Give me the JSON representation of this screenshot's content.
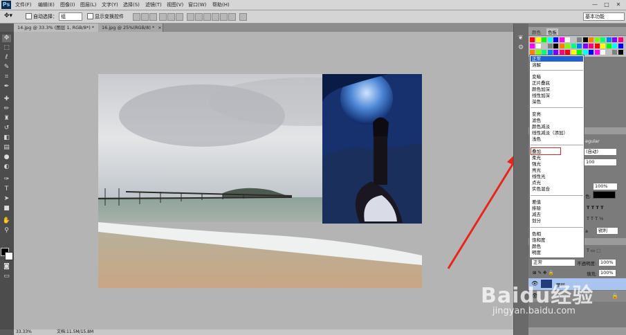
{
  "app": {
    "logo": "Ps",
    "menus": [
      "文件(F)",
      "编辑(E)",
      "图像(I)",
      "图层(L)",
      "文字(Y)",
      "选择(S)",
      "滤镜(T)",
      "视图(V)",
      "窗口(W)",
      "帮助(H)"
    ],
    "window_controls": [
      "—",
      "□",
      "✕"
    ]
  },
  "options": {
    "auto_select_label": "自动选择：",
    "auto_select_value": "组",
    "show_transform_label": "显示变换控件",
    "workspace": "基本功能"
  },
  "tabs": [
    {
      "label": "14.jpg @ 33.3% (图层 1, RGB/8*) *",
      "close": "×"
    },
    {
      "label": "16.jpg @ 25%(RGB/8) *",
      "close": "×"
    }
  ],
  "status": {
    "zoom": "33.33%",
    "doc": "文档:11.5M/15.8M"
  },
  "color_panel": {
    "tabs": [
      "颜色",
      "色板"
    ]
  },
  "blend_modes": {
    "highlighted": "正常",
    "groups": [
      [
        "正常",
        "溶解"
      ],
      [
        "变暗",
        "正片叠底",
        "颜色加深",
        "线性加深",
        "深色"
      ],
      [
        "变亮",
        "滤色",
        "颜色减淡",
        "线性减淡（添加）",
        "浅色"
      ],
      [
        "叠加",
        "柔光",
        "强光",
        "亮光",
        "线性光",
        "点光",
        "实色混合"
      ],
      [
        "差值",
        "排除",
        "减去",
        "划分"
      ],
      [
        "色相",
        "饱和度",
        "颜色",
        "明度"
      ]
    ],
    "boxed": "叠加"
  },
  "char_panel": {
    "regular": "egular",
    "auto": "(自动)",
    "size": "100",
    "scale": "100%",
    "color_label": "色:",
    "aa_label": "a",
    "aa_value": "锐利"
  },
  "layers_panel": {
    "blend_value": "正常",
    "opacity_label": "不透明度:",
    "opacity_value": "100%",
    "fill_label": "填充:",
    "fill_value": "100%",
    "layer_name": "图层"
  },
  "watermark": {
    "brand": "Baidu经验",
    "url": "jingyan.baidu.com"
  },
  "colors": {
    "arrow": "#e8241c",
    "highlight": "#1f5fd6",
    "selected_layer": "#a9c4ee"
  }
}
